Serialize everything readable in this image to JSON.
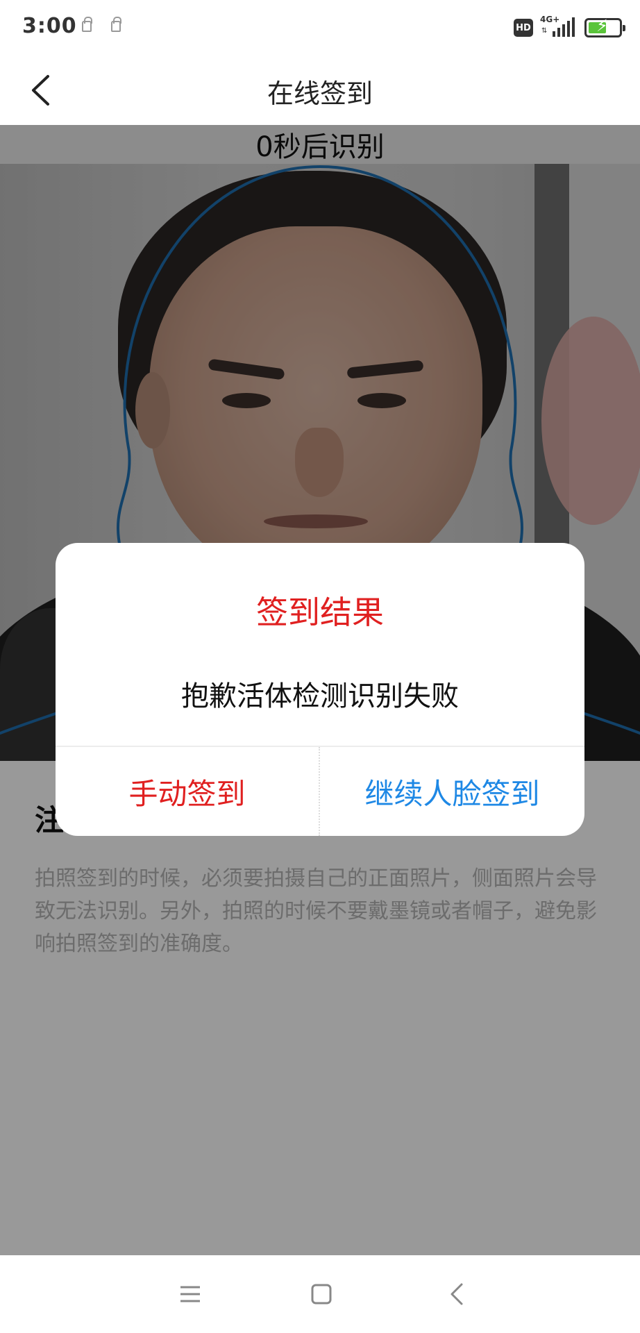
{
  "status_bar": {
    "time": "3:00",
    "network_label": "4G+",
    "badge": "HD",
    "battery_level": 0.6,
    "battery_color": "#5ac43a"
  },
  "nav": {
    "title": "在线签到",
    "back_icon": "chevron-left-icon"
  },
  "camera": {
    "countdown": "0秒后识别",
    "guide_color": "#1e6fb0"
  },
  "notice": {
    "title": "注意事项",
    "body": "拍照签到的时候，必须要拍摄自己的正面照片，侧面照片会导致无法识别。另外，拍照的时候不要戴墨镜或者帽子，避免影响拍照签到的准确度。"
  },
  "dialog": {
    "title": "签到结果",
    "message": "抱歉活体检测识别失败",
    "buttons": {
      "manual": "手动签到",
      "continue": "继续人脸签到"
    },
    "colors": {
      "title": "#e02020",
      "manual": "#e02020",
      "continue": "#1e88e5"
    }
  },
  "system_nav": {
    "icons": [
      "menu-icon",
      "home-icon",
      "back-icon"
    ]
  }
}
